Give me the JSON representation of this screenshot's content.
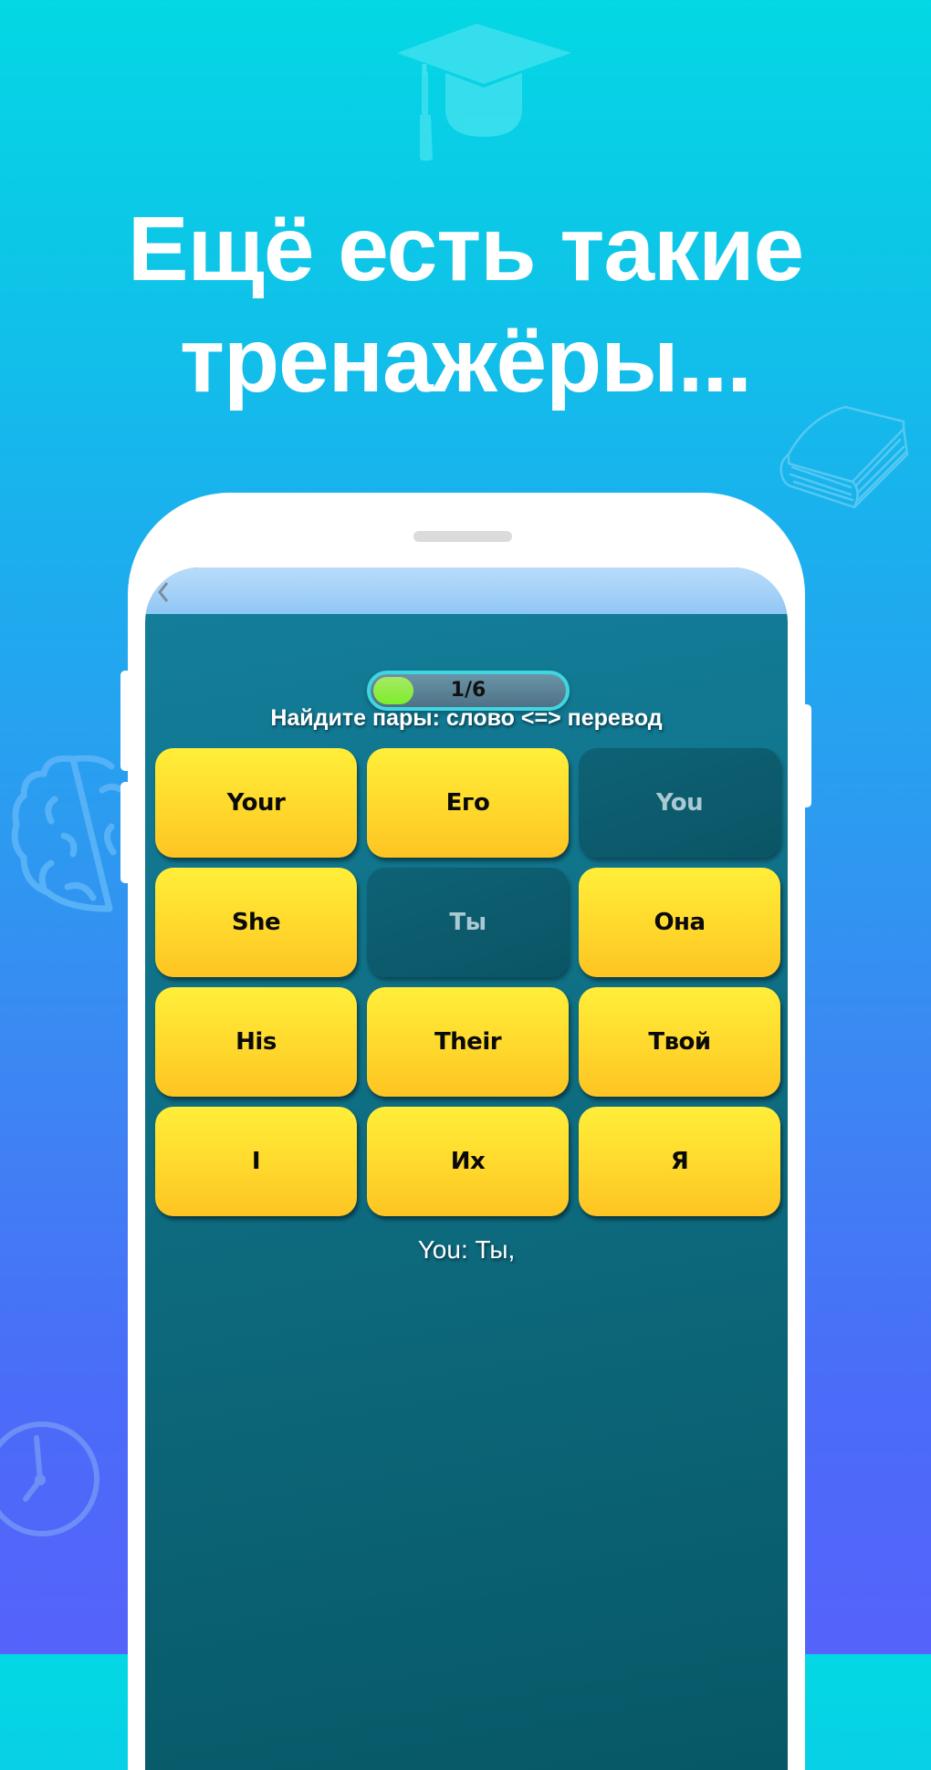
{
  "promo": {
    "headline_line1": "Ещё есть такие",
    "headline_line2": "тренажёры..."
  },
  "decorations": [
    "graduation-cap-icon",
    "book-icon",
    "brain-icon",
    "clock-icon"
  ],
  "app": {
    "back_icon": "chevron-left-icon",
    "progress": {
      "label": "1/6",
      "current": 1,
      "total": 6,
      "fill_fraction": 0.17,
      "fill_color": "#7dee2c",
      "border_color": "#3fd6e2"
    },
    "instruction": "Найдите пары: слово <=> перевод",
    "cards": [
      {
        "label": "Your",
        "state": "active"
      },
      {
        "label": "Его",
        "state": "active"
      },
      {
        "label": "You",
        "state": "matched"
      },
      {
        "label": "She",
        "state": "active"
      },
      {
        "label": "Ты",
        "state": "matched"
      },
      {
        "label": "Она",
        "state": "active"
      },
      {
        "label": "His",
        "state": "active"
      },
      {
        "label": "Their",
        "state": "active"
      },
      {
        "label": "Твой",
        "state": "active"
      },
      {
        "label": "I",
        "state": "active"
      },
      {
        "label": "Их",
        "state": "active"
      },
      {
        "label": "Я",
        "state": "active"
      }
    ],
    "feedback": "You: Ты,",
    "colors": {
      "card_active": "#ffd82c",
      "card_matched": "#0a5566",
      "screen_bg": "#0f6f84"
    }
  }
}
